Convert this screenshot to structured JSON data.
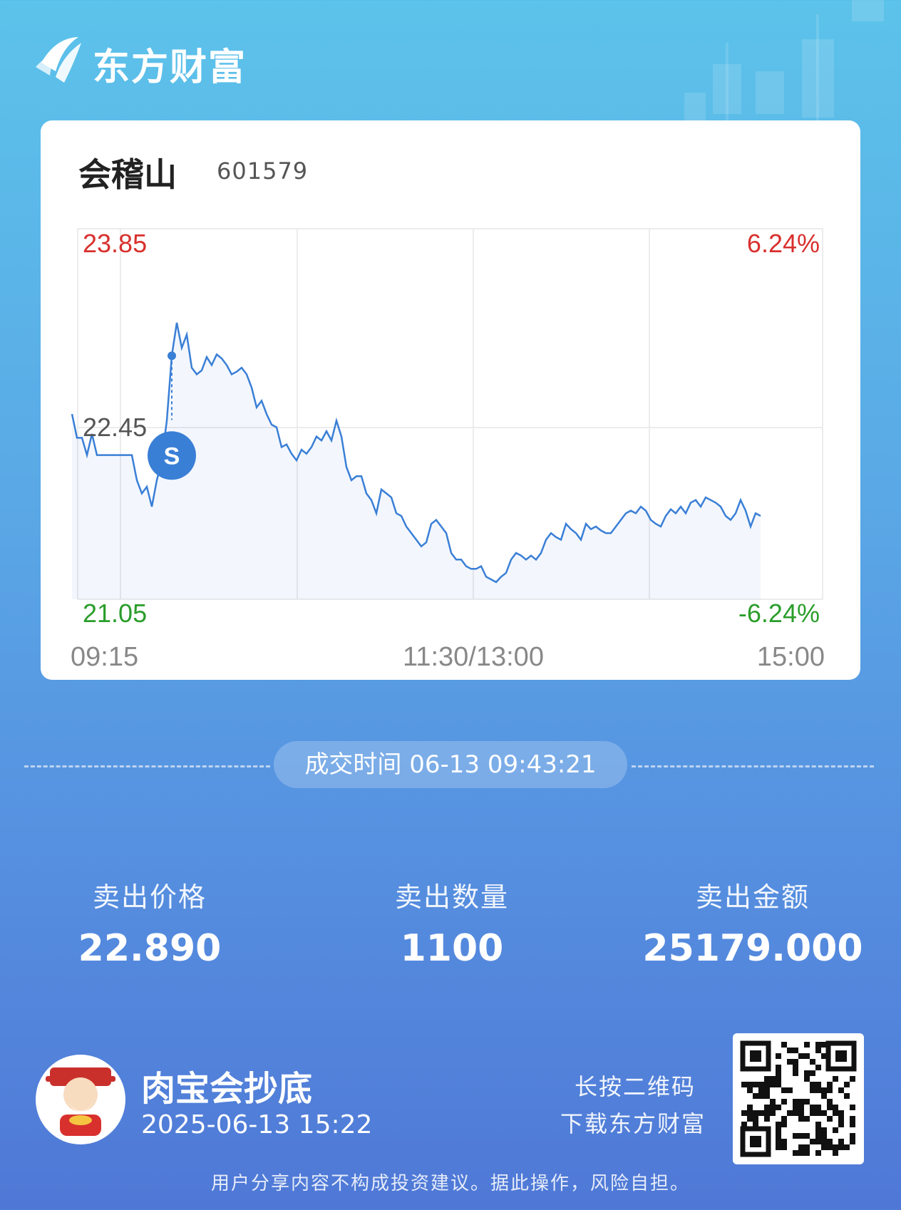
{
  "header": {
    "brand": "东方财富"
  },
  "card": {
    "stock_name": "会稽山",
    "stock_code": "601579",
    "price_high": "23.85",
    "price_mid": "22.45",
    "price_low": "21.05",
    "pct_high": "6.24%",
    "pct_low": "-6.24%",
    "time_start": "09:15",
    "time_mid": "11:30/13:00",
    "time_end": "15:00",
    "marker_label": "S"
  },
  "chart_data": {
    "type": "line",
    "x_range": [
      "09:15",
      "15:00"
    ],
    "ylim": [
      21.05,
      23.85
    ],
    "reference_price": 22.45,
    "marker": {
      "label": "S",
      "price": 22.89,
      "time": "09:43:21"
    },
    "series": [
      {
        "values": [
          22.45,
          22.27,
          22.27,
          22.14,
          22.3,
          22.14,
          22.14,
          22.14,
          22.14,
          22.14,
          22.14,
          22.14,
          22.14,
          21.95,
          21.85,
          21.9,
          21.75,
          21.95,
          22.1,
          22.4,
          22.89,
          23.14,
          22.95,
          23.05,
          22.8,
          22.75,
          22.78,
          22.88,
          22.82,
          22.9,
          22.87,
          22.82,
          22.75,
          22.77,
          22.8,
          22.75,
          22.65,
          22.5,
          22.55,
          22.45,
          22.37,
          22.35,
          22.2,
          22.22,
          22.15,
          22.1,
          22.18,
          22.15,
          22.2,
          22.28,
          22.25,
          22.32,
          22.25,
          22.4,
          22.28,
          22.05,
          21.95,
          21.98,
          21.98,
          21.85,
          21.8,
          21.7,
          21.88,
          21.85,
          21.82,
          21.7,
          21.68,
          21.6,
          21.55,
          21.5,
          21.45,
          21.48,
          21.62,
          21.65,
          21.6,
          21.55,
          21.4,
          21.35,
          21.35,
          21.3,
          21.28,
          21.28,
          21.3,
          21.22,
          21.2,
          21.18,
          21.22,
          21.25,
          21.35,
          21.4,
          21.38,
          21.35,
          21.38,
          21.35,
          21.4,
          21.5,
          21.55,
          21.52,
          21.5,
          21.62,
          21.58,
          21.55,
          21.5,
          21.62,
          21.58,
          21.6,
          21.57,
          21.55,
          21.55,
          21.6,
          21.65,
          21.7,
          21.72,
          21.7,
          21.75,
          21.72,
          21.65,
          21.62,
          21.6,
          21.68,
          21.73,
          21.7,
          21.75,
          21.7,
          21.78,
          21.8,
          21.75,
          21.82,
          21.8,
          21.78,
          21.75,
          21.68,
          21.65,
          21.7,
          21.8,
          21.72,
          21.6,
          21.7,
          21.68
        ]
      }
    ],
    "grid": true
  },
  "trade": {
    "label": "成交时间",
    "time": "06-13 09:43:21"
  },
  "stats": [
    {
      "label": "卖出价格",
      "value": "22.890"
    },
    {
      "label": "卖出数量",
      "value": "1100"
    },
    {
      "label": "卖出金额",
      "value": "25179.000"
    }
  ],
  "footer": {
    "user_name": "肉宝会抄底",
    "share_time": "2025-06-13  15:22",
    "qr_hint1": "长按二维码",
    "qr_hint2": "下载东方财富",
    "disclaimer": "用户分享内容不构成投资建议。据此操作，风险自担。"
  },
  "colors": {
    "up": "#d8302d",
    "down": "#2a9d2a",
    "line": "#3a7fd6",
    "neutral": "#555555"
  }
}
